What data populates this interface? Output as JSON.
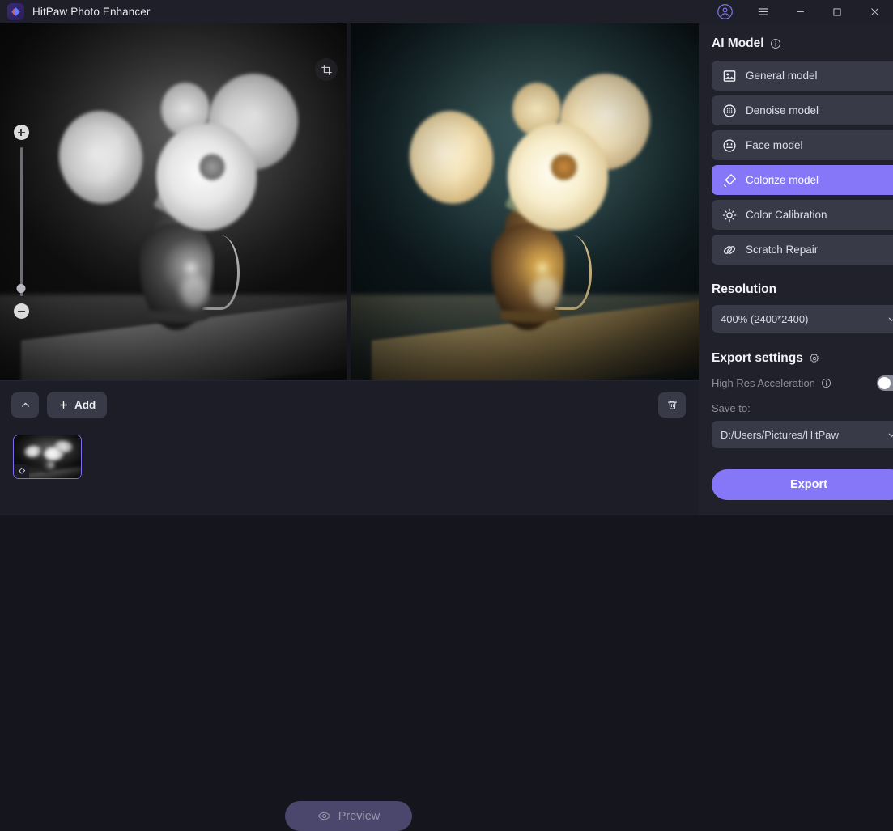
{
  "window": {
    "title": "HitPaw Photo Enhancer",
    "logo_icon": "hitpaw-logo-icon",
    "controls": {
      "account_icon": "account-circle-icon",
      "menu_icon": "hamburger-menu-icon",
      "minimize_icon": "minimize-icon",
      "maximize_icon": "maximize-icon",
      "close_icon": "close-icon"
    }
  },
  "preview": {
    "crop_icon": "crop-icon",
    "zoom": {
      "zoom_in_icon": "zoom-in-icon",
      "zoom_out_icon": "zoom-out-icon",
      "slider_handle": "zoom-slider-handle"
    },
    "before_label": "original-grayscale-photo",
    "after_label": "colorized-photo"
  },
  "toolbar": {
    "collapse_icon": "chevron-up-icon",
    "add_label": "Add",
    "add_icon": "plus-icon",
    "preview_label": "Preview",
    "preview_icon": "eye-icon",
    "delete_icon": "trash-icon"
  },
  "filmstrip": {
    "thumbnail_badge_icon": "colorize-badge-icon"
  },
  "sidebar": {
    "ai_model": {
      "title": "AI Model",
      "info_icon": "info-icon",
      "models": [
        {
          "label": "General model",
          "icon": "image-icon",
          "active": false
        },
        {
          "label": "Denoise model",
          "icon": "denoise-grid-icon",
          "active": false
        },
        {
          "label": "Face model",
          "icon": "face-icon",
          "active": false
        },
        {
          "label": "Colorize model",
          "icon": "colorize-icon",
          "active": true
        },
        {
          "label": "Color Calibration",
          "icon": "brightness-icon",
          "active": false
        },
        {
          "label": "Scratch Repair",
          "icon": "scratch-repair-icon",
          "active": false
        }
      ]
    },
    "resolution": {
      "title": "Resolution",
      "selected": "400% (2400*2400)",
      "chevron_icon": "chevron-down-icon"
    },
    "export_settings": {
      "title": "Export settings",
      "gear_icon": "gear-icon",
      "high_res_label": "High Res Acceleration",
      "high_res_info_icon": "info-icon",
      "high_res_enabled": false,
      "save_to_label": "Save to:",
      "save_to_path": "D:/Users/Pictures/HitPaw",
      "save_to_chevron_icon": "chevron-down-icon",
      "export_label": "Export"
    }
  },
  "colors": {
    "accent": "#8577f7",
    "sidebar_bg": "#20212b",
    "button_bg": "#383a47",
    "titlebar_bg": "#1e1f29",
    "canvas_bg": "#16171f"
  }
}
